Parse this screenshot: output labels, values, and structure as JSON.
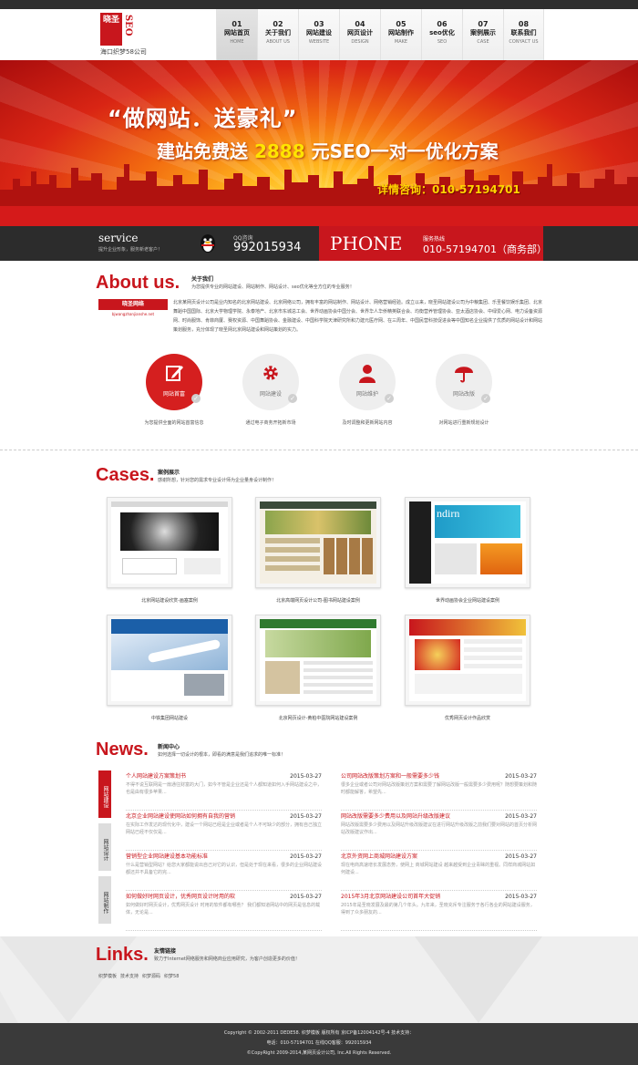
{
  "header": {
    "logo_seal": "晓圣",
    "logo_seo": "SEO",
    "logo_sub": "海口织梦58公司",
    "nav": [
      {
        "num": "01",
        "zh": "网站首页",
        "en": "HOME"
      },
      {
        "num": "02",
        "zh": "关于我们",
        "en": "ABOUT US"
      },
      {
        "num": "03",
        "zh": "网站建设",
        "en": "WEBSITE"
      },
      {
        "num": "04",
        "zh": "网页设计",
        "en": "DESIGN"
      },
      {
        "num": "05",
        "zh": "网站制作",
        "en": "MAKE"
      },
      {
        "num": "06",
        "zh": "seo优化",
        "en": "SEO"
      },
      {
        "num": "07",
        "zh": "案例展示",
        "en": "CASE"
      },
      {
        "num": "08",
        "zh": "联系我们",
        "en": "CONYACT US"
      }
    ]
  },
  "banner": {
    "line1": "“做网站．送豪礼”",
    "line2_pre": "建站免费送",
    "line2_hl": "2888",
    "line2_post": "元SEO一对一优化方案",
    "line3": "详情咨询：010-57194701"
  },
  "service_bar": {
    "title": "service",
    "subtitle": "提升企业形象，服务新老客户！",
    "qq_label": "QQ咨询",
    "qq_number": "992015934",
    "phone_word": "PHONE",
    "hotline_label": "服务热线",
    "hotline_number": "010-57194701（商务部）"
  },
  "about": {
    "title": "About us.",
    "zh": "关于我们",
    "sub": "为您提供专业的网站建设、网站制作、网站设计、seo优化等全方位的专业服务！",
    "tag": "晓圣网络",
    "tag_sub": "bjwangzhanjianshe.net",
    "text": "北京某网页设计公司是业内知名的北京网站建设、北京网络公司，拥有丰富的网站制作、网站设计、网络营销经验。成立以来，晓圣网站建设公司为中粮集团、乐圣餐饮娱乐集团、北京舞蹈中国国际、北京大学物理学院、永泰地产、北京市东城总工会、世界动画协会中国分会、世界华人华侨精英联合会、均衡营养管理协会、亚太酒店协会、中绿爱心网、电力设备资源网、时尚服饰、肯菲商厦、赛权资源、中国舞蹈协会、金融建设、中国科学院天津研究所和力建元医疗网、在三周年、中国民营科技促进会等中国知名企业提供了优质的网站设计和网站策划服务，充分体现了晓圣网北京网站建设和网站策划的实力。",
    "services": [
      {
        "name": "网站首富",
        "icon": "edit-icon",
        "desc": "为您提供全面的网站首富信息"
      },
      {
        "name": "网站建设",
        "icon": "gear-icon",
        "desc": "通过电子商务开拓新市场"
      },
      {
        "name": "网站维护",
        "icon": "user-icon",
        "desc": "及时调整和更新网站内容"
      },
      {
        "name": "网站改版",
        "icon": "umbrella-icon",
        "desc": "对网站进行重新规划设计"
      }
    ]
  },
  "cases": {
    "title": "Cases.",
    "zh": "案例展示",
    "sub": "感谢所想，针对您的需求专业设计师为企业量身设计制作！",
    "items": [
      {
        "caption": "北京网站建设欣赏-画塞案例"
      },
      {
        "caption": "北京高端网页设计公司-图书网站建设案例"
      },
      {
        "caption": "世界动画协会企业网站建设案例"
      },
      {
        "caption": "中铁集团网站建设"
      },
      {
        "caption": "北京网页设计-黄柏中医院网站建设案例"
      },
      {
        "caption": "优秀网页设计作品欣赏"
      }
    ]
  },
  "news": {
    "title": "News.",
    "zh": "新闻中心",
    "sub": "如何选择一切设计的根本，即看的满意是我们追求的唯一标准！",
    "tabs": [
      "网站建设",
      "网站设计",
      "网站制作"
    ],
    "left": [
      {
        "title": "个人网站建设方案策划书",
        "date": "2015-03-27",
        "summary": "不得不说互联网是一扇通往财富的大门，如今不管是企业还是个人都知道如何入手网站建设之中，也是由有很多苹果..."
      },
      {
        "title": "北京企业网站建设使网站如何拥有自我的营销",
        "date": "2015-03-27",
        "summary": "在实际工作发达的现代化中，建设一个网站已经是企业或者是个人不可缺少的部分，拥有自己独立网站已经不仅仅是..."
      },
      {
        "title": "营销型企业网站建设基本功能标准",
        "date": "2015-03-27",
        "summary": "什么是营销型网站？给您大家都能说出自己对它的认识，但是处于现在来看，很多的企业网站建设都还并不具备它的完..."
      },
      {
        "title": "如何做好时网页设计，优秀网页设计时用的软",
        "date": "2015-03-27",
        "summary": "如何做好时网页设计，优秀网页设计 时用的软件都有哪些？ 我们都知道网站中的网页是信息的载体，无论是..."
      }
    ],
    "right": [
      {
        "title": "公司网站改版策划方案和一般需要多少钱",
        "date": "2015-03-27",
        "summary": "很多企业或者公司对网站改版策划方案和需要了解网站改版一般需要多少费用呢？随想要策划和随时都能解答，希望先..."
      },
      {
        "title": "网站改版需要多少费用以及网站升级改版建议",
        "date": "2015-03-27",
        "summary": "网站改版需要多少费用以及网站升级改版建议在进行网站升级改版之前我们要对网站的首页分析网站改版建议作出..."
      },
      {
        "title": "北京外资网上商城网站建设方案",
        "date": "2015-03-27",
        "summary": "现在电商高速增长发展态势，使网上 商城网站建设 越来越受到企业青睐的重视。同样商城网站如何建设..."
      },
      {
        "title": "2015年3月北京网站建设公司首年大促销",
        "date": "2015-03-27",
        "summary": "2015年是圣晓发展及最的第几个年头。九年来，圣晓充斥专注服务于各行各业的网站建设服务，得到了众多朋友的..."
      }
    ]
  },
  "links": {
    "title": "Links.",
    "zh": "友情链接",
    "sub": "致力于Internet网络服务和网络商业应用研究，为客户创造更多的价值！",
    "items": [
      "织梦模板",
      "技术支持",
      "织梦源码",
      "织梦58"
    ]
  },
  "footer": {
    "line1": "Copyright © 2002-2011 DEDE58. 织梦模板 版权所有   京ICP备12004142号-4   技术支持：",
    "line2": "电话：010-57194701 在线QQ客服：992015934",
    "line3": "©CopyRight 2009-2014,某网页设计公司, Inc.All Rights Reserved."
  },
  "colors": {
    "accent": "#c8161d",
    "dark": "#2c2c2c"
  }
}
